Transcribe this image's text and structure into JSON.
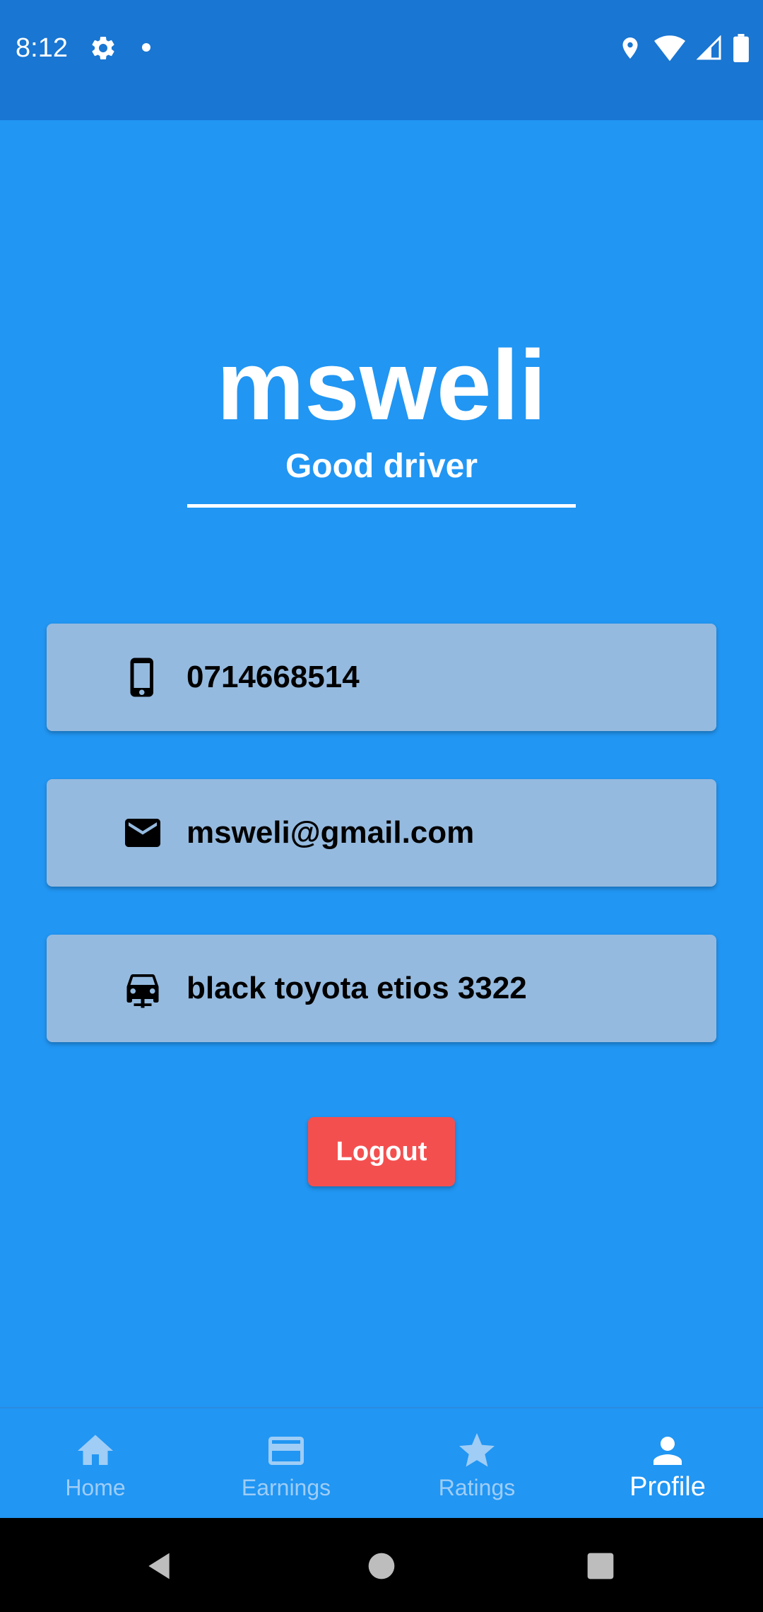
{
  "status_bar": {
    "time": "8:12",
    "icons_left": [
      "gear-icon",
      "notification-dot"
    ],
    "icons_right": [
      "location-icon",
      "wifi-icon",
      "signal-icon",
      "battery-icon"
    ]
  },
  "profile": {
    "name": "msweli",
    "subtitle": "Good driver"
  },
  "info_cards": [
    {
      "icon": "phone-icon",
      "value": "0714668514"
    },
    {
      "icon": "email-icon",
      "value": "msweli@gmail.com"
    },
    {
      "icon": "car-icon",
      "value": "black toyota etios 3322"
    }
  ],
  "logout": {
    "label": "Logout"
  },
  "bottom_nav": {
    "items": [
      {
        "label": "Home",
        "icon": "home-icon",
        "active": false
      },
      {
        "label": "Earnings",
        "icon": "credit-card-icon",
        "active": false
      },
      {
        "label": "Ratings",
        "icon": "star-icon",
        "active": false
      },
      {
        "label": "Profile",
        "icon": "person-icon",
        "active": true
      }
    ]
  },
  "colors": {
    "background": "#2196F3",
    "status_bar": "#1976D2",
    "card": "#95BADF",
    "logout": "#F44F4F",
    "nav_inactive": "#9FCDF6",
    "nav_active": "#FFFFFF"
  }
}
